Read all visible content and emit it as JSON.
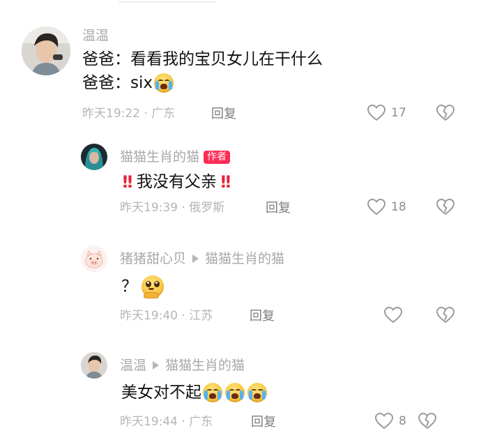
{
  "comments": [
    {
      "user": "温温",
      "line1": "爸爸：看看我的宝贝女儿在干什么",
      "line2_prefix": "爸爸：six",
      "meta": "昨天19:22 · 广东",
      "reply_label": "回复",
      "likes": "17"
    },
    {
      "user": "猫猫生肖的猫",
      "badge": "作者",
      "text": "我没有父亲",
      "meta": "昨天19:39 · 俄罗斯",
      "reply_label": "回复",
      "likes": "18"
    },
    {
      "user": "猪猪甜心贝",
      "reply_to": "猫猫生肖的猫",
      "text": "？",
      "meta": "昨天19:40 · 江苏",
      "reply_label": "回复",
      "likes": ""
    },
    {
      "user": "温温",
      "reply_to": "猫猫生肖的猫",
      "text": "美女对不起",
      "meta": "昨天19:44 · 广东",
      "reply_label": "回复",
      "likes": "8"
    }
  ],
  "icons": {
    "like": "heart-outline-icon",
    "dislike": "broken-heart-icon",
    "emoji_cry": "loudly-crying-face-emoji",
    "emoji_plead": "pleading-face-emoji",
    "exclamation": "double-exclamation-icon"
  },
  "colors": {
    "author_badge": "#fe2c55",
    "exclamation": "#e8263b",
    "secondary_text": "#a8a8a8"
  }
}
